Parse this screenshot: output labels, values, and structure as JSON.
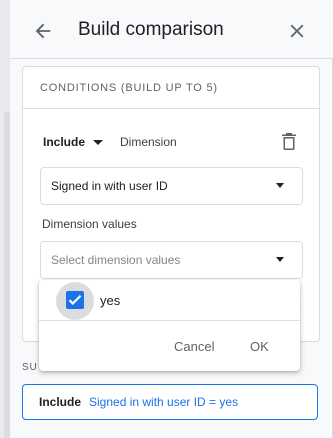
{
  "header": {
    "title": "Build comparison",
    "back_icon": "arrow-back-icon",
    "close_icon": "close-icon"
  },
  "conditions": {
    "title": "CONDITIONS (BUILD UP TO 5)",
    "include_label": "Include",
    "dimension_label": "Dimension",
    "dimension_selected": "Signed in with user ID",
    "dimension_values_label": "Dimension values",
    "dimension_values_placeholder": "Select dimension values"
  },
  "popup": {
    "option_label": "yes",
    "option_checked": true,
    "cancel_label": "Cancel",
    "ok_label": "OK"
  },
  "summary": {
    "label": "SU",
    "include": "Include",
    "condition": "Signed in with user ID = yes"
  },
  "colors": {
    "accent": "#1a73e8",
    "text": "#202124",
    "muted": "#5f6368",
    "border": "#dadce0"
  }
}
